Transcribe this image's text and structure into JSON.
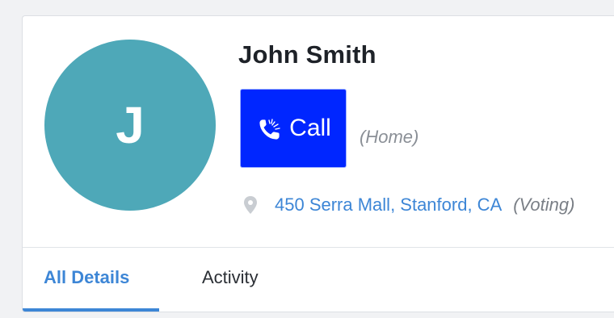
{
  "contact": {
    "initial": "J",
    "name": "John Smith",
    "avatar_color": "#4ea8b8"
  },
  "phone": {
    "call_label": "Call",
    "type": "(Home)",
    "icon": "phone-icon",
    "button_color": "#0026ff"
  },
  "address": {
    "icon": "map-pin-icon",
    "text": "450 Serra Mall, Stanford, CA",
    "type": "(Voting)",
    "link_color": "#3d86d6"
  },
  "tabs": [
    {
      "label": "All Details",
      "active": true
    },
    {
      "label": "Activity",
      "active": false
    }
  ]
}
